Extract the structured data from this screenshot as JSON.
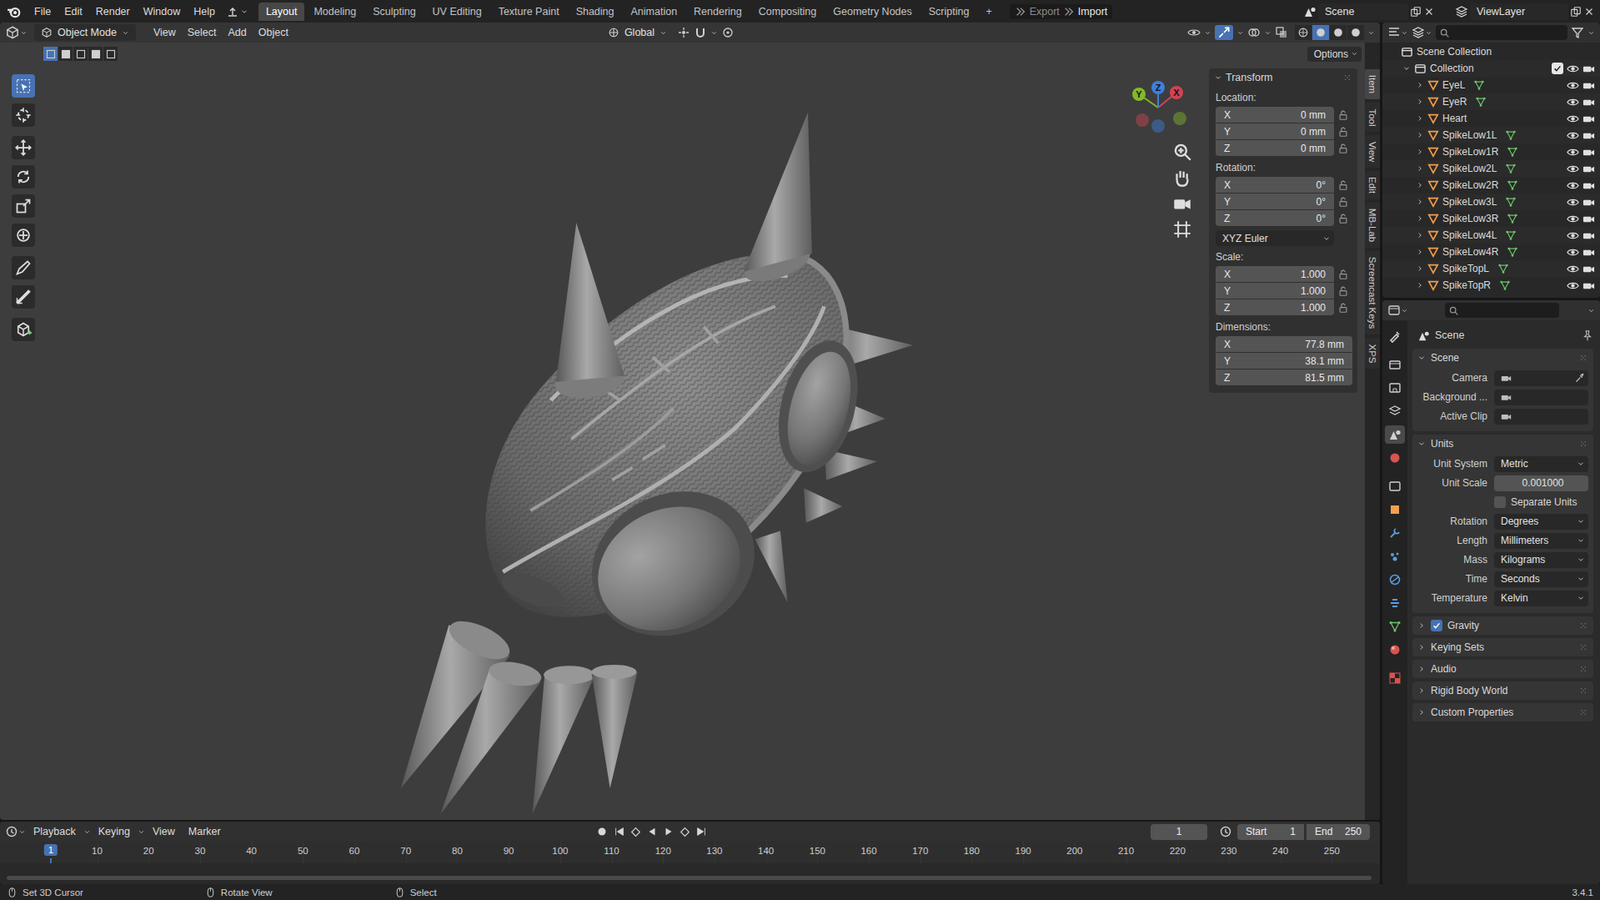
{
  "topbar": {
    "menus": [
      "File",
      "Edit",
      "Render",
      "Window",
      "Help"
    ],
    "workspaces": [
      {
        "label": "Layout",
        "selected": true
      },
      {
        "label": "Modeling",
        "selected": false
      },
      {
        "label": "Sculpting",
        "selected": false
      },
      {
        "label": "UV Editing",
        "selected": false
      },
      {
        "label": "Texture Paint",
        "selected": false
      },
      {
        "label": "Shading",
        "selected": false
      },
      {
        "label": "Animation",
        "selected": false
      },
      {
        "label": "Rendering",
        "selected": false
      },
      {
        "label": "Compositing",
        "selected": false
      },
      {
        "label": "Geometry Nodes",
        "selected": false
      },
      {
        "label": "Scripting",
        "selected": false
      }
    ],
    "add_workspace": "+",
    "export": "Export",
    "import": "Import",
    "scene": "Scene",
    "view_layer": "ViewLayer"
  },
  "viewport_header": {
    "mode": "Object Mode",
    "menus": [
      "View",
      "Select",
      "Add",
      "Object"
    ],
    "orientation": "Global",
    "options": "Options",
    "select_modes": [
      {
        "selected": true
      },
      {
        "selected": false
      },
      {
        "selected": false
      },
      {
        "selected": false
      },
      {
        "selected": false
      }
    ],
    "shading": [
      {
        "selected": false
      },
      {
        "selected": true
      },
      {
        "selected": false
      },
      {
        "selected": false
      }
    ]
  },
  "tools": [
    {
      "selected": true
    },
    {
      "selected": false
    },
    {
      "selected": false
    },
    {
      "selected": false
    },
    {
      "selected": false
    },
    {
      "selected": false
    },
    {
      "selected": false
    },
    {
      "selected": false
    },
    {
      "selected": false
    }
  ],
  "gizmo": {
    "axes": [
      {
        "label": "X",
        "color": "#d04452"
      },
      {
        "label": "Y",
        "color": "#84b82b"
      },
      {
        "label": "Z",
        "color": "#3e7fe0"
      }
    ]
  },
  "transform": {
    "title": "Transform",
    "expanded": true,
    "groups": [
      {
        "label": "Location:",
        "fields": [
          {
            "axis": "X",
            "value": "0 mm",
            "locked": false
          },
          {
            "axis": "Y",
            "value": "0 mm",
            "locked": false
          },
          {
            "axis": "Z",
            "value": "0 mm",
            "locked": false
          }
        ]
      },
      {
        "label": "Rotation:",
        "fields": [
          {
            "axis": "X",
            "value": "0°",
            "locked": false
          },
          {
            "axis": "Y",
            "value": "0°",
            "locked": false
          },
          {
            "axis": "Z",
            "value": "0°",
            "locked": false
          }
        ],
        "mode": "XYZ Euler"
      },
      {
        "label": "Scale:",
        "fields": [
          {
            "axis": "X",
            "value": "1.000",
            "locked": false
          },
          {
            "axis": "Y",
            "value": "1.000",
            "locked": false
          },
          {
            "axis": "Z",
            "value": "1.000",
            "locked": false
          }
        ]
      },
      {
        "label": "Dimensions:",
        "fields": [
          {
            "axis": "X",
            "value": "77.8 mm"
          },
          {
            "axis": "Y",
            "value": "38.1 mm"
          },
          {
            "axis": "Z",
            "value": "81.5 mm"
          }
        ]
      }
    ]
  },
  "side_tabs": [
    {
      "label": "Item",
      "selected": true
    },
    {
      "label": "Tool",
      "selected": false
    },
    {
      "label": "View",
      "selected": false
    },
    {
      "label": "Edit",
      "selected": false
    },
    {
      "label": "MB-Lab",
      "selected": false
    },
    {
      "label": "Screencast Keys",
      "selected": false
    },
    {
      "label": "XPS",
      "selected": false
    }
  ],
  "outliner": {
    "root": "Scene Collection",
    "collection": {
      "name": "Collection",
      "expanded": true,
      "checked": true,
      "visible": true,
      "renderable": true
    },
    "objects": [
      {
        "name": "EyeL",
        "has_mesh_data": true,
        "visible": true,
        "renderable": true
      },
      {
        "name": "EyeR",
        "has_mesh_data": true,
        "visible": true,
        "renderable": true
      },
      {
        "name": "Heart",
        "has_mesh_data": false,
        "visible": true,
        "renderable": true
      },
      {
        "name": "SpikeLow1L",
        "has_mesh_data": true,
        "visible": true,
        "renderable": true
      },
      {
        "name": "SpikeLow1R",
        "has_mesh_data": true,
        "visible": true,
        "renderable": true
      },
      {
        "name": "SpikeLow2L",
        "has_mesh_data": true,
        "visible": true,
        "renderable": true
      },
      {
        "name": "SpikeLow2R",
        "has_mesh_data": true,
        "visible": true,
        "renderable": true
      },
      {
        "name": "SpikeLow3L",
        "has_mesh_data": true,
        "visible": true,
        "renderable": true
      },
      {
        "name": "SpikeLow3R",
        "has_mesh_data": true,
        "visible": true,
        "renderable": true
      },
      {
        "name": "SpikeLow4L",
        "has_mesh_data": true,
        "visible": true,
        "renderable": true
      },
      {
        "name": "SpikeLow4R",
        "has_mesh_data": true,
        "visible": true,
        "renderable": true
      },
      {
        "name": "SpikeTopL",
        "has_mesh_data": true,
        "visible": true,
        "renderable": true
      },
      {
        "name": "SpikeTopR",
        "has_mesh_data": true,
        "visible": true,
        "renderable": true
      }
    ]
  },
  "properties": {
    "context": "Scene",
    "tabs": [
      {
        "selected": false
      },
      {
        "selected": false
      },
      {
        "selected": false
      },
      {
        "selected": false
      },
      {
        "selected": true
      },
      {
        "selected": false
      },
      {
        "selected": false
      },
      {
        "selected": false
      },
      {
        "selected": false
      },
      {
        "selected": false
      },
      {
        "selected": false
      },
      {
        "selected": false
      },
      {
        "selected": false
      },
      {
        "selected": false
      },
      {
        "selected": false
      }
    ],
    "panels": [
      {
        "title": "Scene",
        "expanded": true,
        "rows": [
          {
            "kind": "id",
            "label": "Camera",
            "eyedropper": true
          },
          {
            "kind": "id",
            "label": "Background ...",
            "eyedropper": false
          },
          {
            "kind": "id",
            "label": "Active Clip",
            "eyedropper": false
          }
        ]
      },
      {
        "title": "Units",
        "expanded": true,
        "rows": [
          {
            "kind": "enum",
            "label": "Unit System",
            "value": "Metric"
          },
          {
            "kind": "number",
            "label": "Unit Scale",
            "value": "0.001000"
          },
          {
            "kind": "checkbox",
            "label": "Separate Units",
            "checked": false
          },
          {
            "kind": "enum",
            "label": "Rotation",
            "value": "Degrees"
          },
          {
            "kind": "enum",
            "label": "Length",
            "value": "Millimeters"
          },
          {
            "kind": "enum",
            "label": "Mass",
            "value": "Kilograms"
          },
          {
            "kind": "enum",
            "label": "Time",
            "value": "Seconds"
          },
          {
            "kind": "enum",
            "label": "Temperature",
            "value": "Kelvin"
          }
        ]
      },
      {
        "title": "Gravity",
        "expanded": false,
        "checked": true
      },
      {
        "title": "Keying Sets",
        "expanded": false
      },
      {
        "title": "Audio",
        "expanded": false
      },
      {
        "title": "Rigid Body World",
        "expanded": false
      },
      {
        "title": "Custom Properties",
        "expanded": false
      }
    ]
  },
  "timeline": {
    "menus": [
      "Playback",
      "Keying",
      "View",
      "Marker"
    ],
    "current_frame": "1",
    "start_label": "Start",
    "start": "1",
    "end_label": "End",
    "end": "250",
    "playhead": "1",
    "ticks": [
      "10",
      "20",
      "30",
      "40",
      "50",
      "60",
      "70",
      "80",
      "90",
      "100",
      "110",
      "120",
      "130",
      "140",
      "150",
      "160",
      "170",
      "180",
      "190",
      "200",
      "210",
      "220",
      "230",
      "240",
      "250"
    ]
  },
  "status_bar": {
    "hints": [
      "Set 3D Cursor",
      "Rotate View",
      "Select"
    ],
    "version": "3.4.1"
  }
}
